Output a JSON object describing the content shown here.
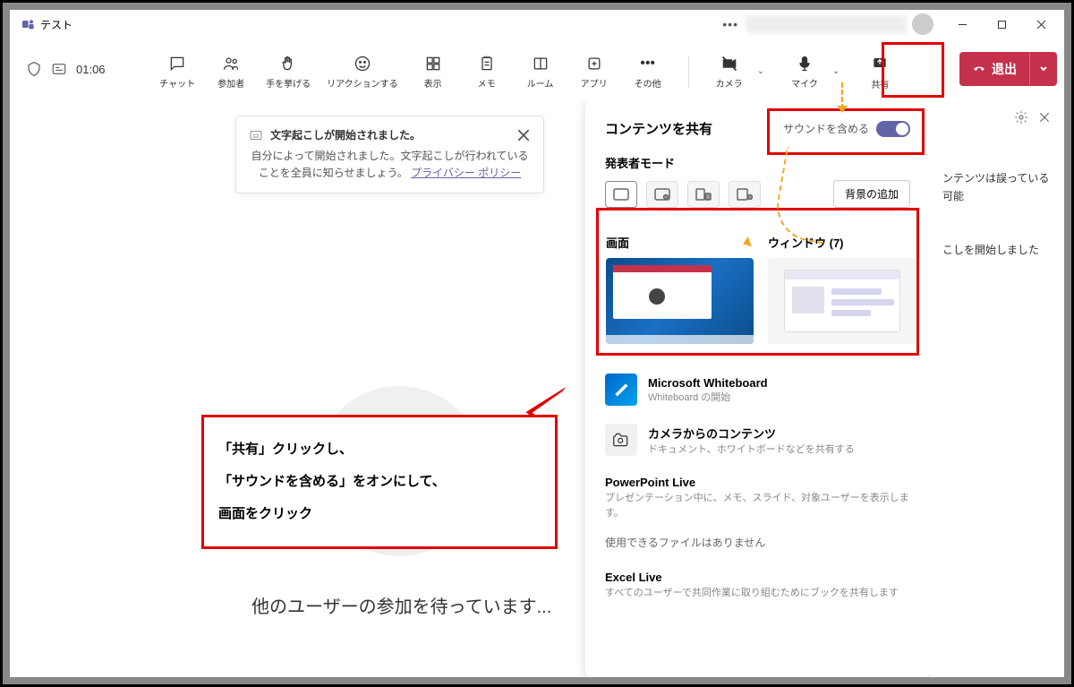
{
  "window_title": "テスト",
  "timer": "01:06",
  "toolbar": {
    "chat": "チャット",
    "participants": "参加者",
    "raise_hand": "手を挙げる",
    "reaction": "リアクションする",
    "view": "表示",
    "notes": "メモ",
    "rooms": "ルーム",
    "apps": "アプリ",
    "more": "その他",
    "camera": "カメラ",
    "mic": "マイク",
    "share": "共有"
  },
  "leave_label": "退出",
  "toast": {
    "title": "文字起こしが開始されました。",
    "body_prefix": "自分によって開始されました。文字起こしが行われていることを全員に知らせましょう。",
    "link": "プライバシー ポリシー"
  },
  "waiting": "他のユーザーの参加を待っています...",
  "callout": {
    "line1": "「共有」クリックし、",
    "line2": "「サウンドを含める」をオンにして、",
    "line3": "画面をクリック"
  },
  "share_panel": {
    "title": "コンテンツを共有",
    "include_sound": "サウンドを含める",
    "presenter_mode": "発表者モード",
    "add_background": "背景の追加",
    "screen": "画面",
    "window": "ウィンドウ (7)",
    "whiteboard_title": "Microsoft Whiteboard",
    "whiteboard_sub": "Whiteboard の開始",
    "camera_title": "カメラからのコンテンツ",
    "camera_sub": "ドキュメント、ホワイトボードなどを共有する",
    "ppt_title": "PowerPoint Live",
    "ppt_sub": "プレゼンテーション中に、メモ、スライド、対象ユーザーを表示します。",
    "no_files": "使用できるファイルはありません",
    "excel_title": "Excel Live",
    "excel_sub": "すべてのユーザーで共同作業に取り組むためにブックを共有します"
  },
  "side": {
    "text1": "ンテンツは誤っている可能",
    "text2": "こしを開始しました"
  }
}
